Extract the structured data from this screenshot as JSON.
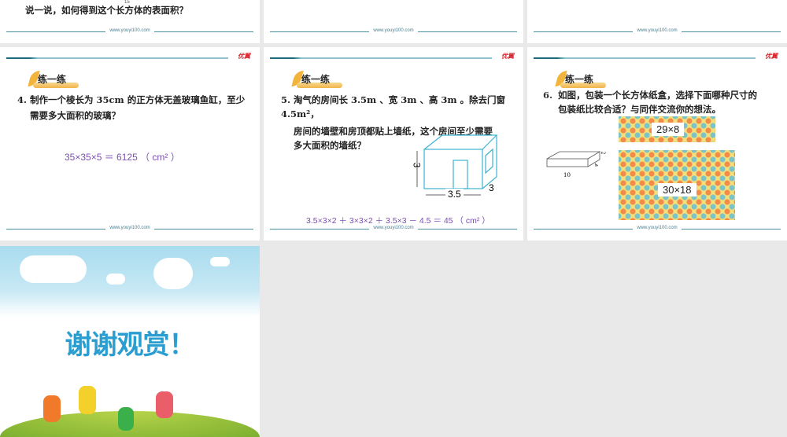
{
  "footer_url": "www.youyi100.com",
  "logo_text": "优翼",
  "badge_label": "练一练",
  "slide_top_left": {
    "page_mark": "15",
    "question": "说一说，如何得到这个长方体的表面积？"
  },
  "slide4": {
    "question_line1": "4. 制作一个棱长为 35cm 的正方体无盖玻璃鱼缸，至少",
    "question_line2": "需要多大面积的玻璃？",
    "answer": "35×35×5 ＝ 6125 （ cm² ）"
  },
  "slide5": {
    "question_line1": "5. 淘气的房间长 3.5m 、宽 3m 、高 3m 。除去门窗",
    "question_line2": "4.5m²，",
    "question_line3": "房间的墙壁和房顶都贴上墙纸，这个房间至少需要",
    "question_line4": "多大面积的墙纸？",
    "dim_height": "3",
    "dim_length": "3.5",
    "dim_width": "3",
    "answer": "3.5×3×2 ＋ 3×3×2 ＋ 3.5×3 － 4.5 ＝ 45 （ cm² ）"
  },
  "slide6": {
    "number": "6.",
    "question_line1": "如图，包装一个长方体纸盒，选择下面哪种尺寸的",
    "question_line2": "包装纸比较合适？与同伴交流你的想法。",
    "box_length": "10",
    "box_height": "2",
    "box_width": "4",
    "paper_small": "29×8",
    "paper_large": "30×18"
  },
  "slide_end": {
    "title": "谢谢观赏！"
  }
}
